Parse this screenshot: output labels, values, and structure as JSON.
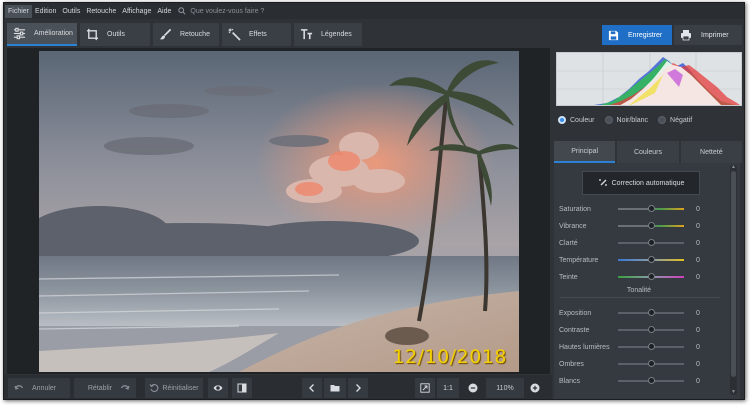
{
  "menu": {
    "items": [
      "Fichier",
      "Edition",
      "Outils",
      "Retouche",
      "Affichage",
      "Aide"
    ],
    "search_placeholder": "Que voulez-vous faire ?"
  },
  "toolbar": {
    "tabs": [
      "Amélioration",
      "Outils",
      "Retouche",
      "Effets",
      "Légendes"
    ],
    "save_label": "Enregistrer",
    "print_label": "Imprimer"
  },
  "photo": {
    "date_stamp": "12/10/2018"
  },
  "bottombar": {
    "undo_label": "Annuler",
    "redo_label": "Rétablir",
    "reset_label": "Réinitialiser",
    "ratio_label": "1:1",
    "zoom_value": "110%"
  },
  "panel": {
    "color_modes": [
      "Couleur",
      "Noir/blanc",
      "Négatif"
    ],
    "subtabs": [
      "Principal",
      "Couleurs",
      "Netteté"
    ],
    "auto_correction_label": "Correction automatique",
    "sliders_color": [
      {
        "label": "Saturation",
        "value": "0"
      },
      {
        "label": "Vibrance",
        "value": "0"
      },
      {
        "label": "Clarté",
        "value": "0"
      },
      {
        "label": "Température",
        "value": "0"
      },
      {
        "label": "Teinte",
        "value": "0"
      }
    ],
    "tonality_title": "Tonalité",
    "sliders_tone": [
      {
        "label": "Exposition",
        "value": "0"
      },
      {
        "label": "Contraste",
        "value": "0"
      },
      {
        "label": "Hautes lumières",
        "value": "0"
      },
      {
        "label": "Ombres",
        "value": "0"
      },
      {
        "label": "Blancs",
        "value": "0"
      }
    ]
  },
  "colors": {
    "accent": "#1f6fc7",
    "tab_active_underline": "#2a81d6",
    "date_stamp": "#f5d000"
  }
}
